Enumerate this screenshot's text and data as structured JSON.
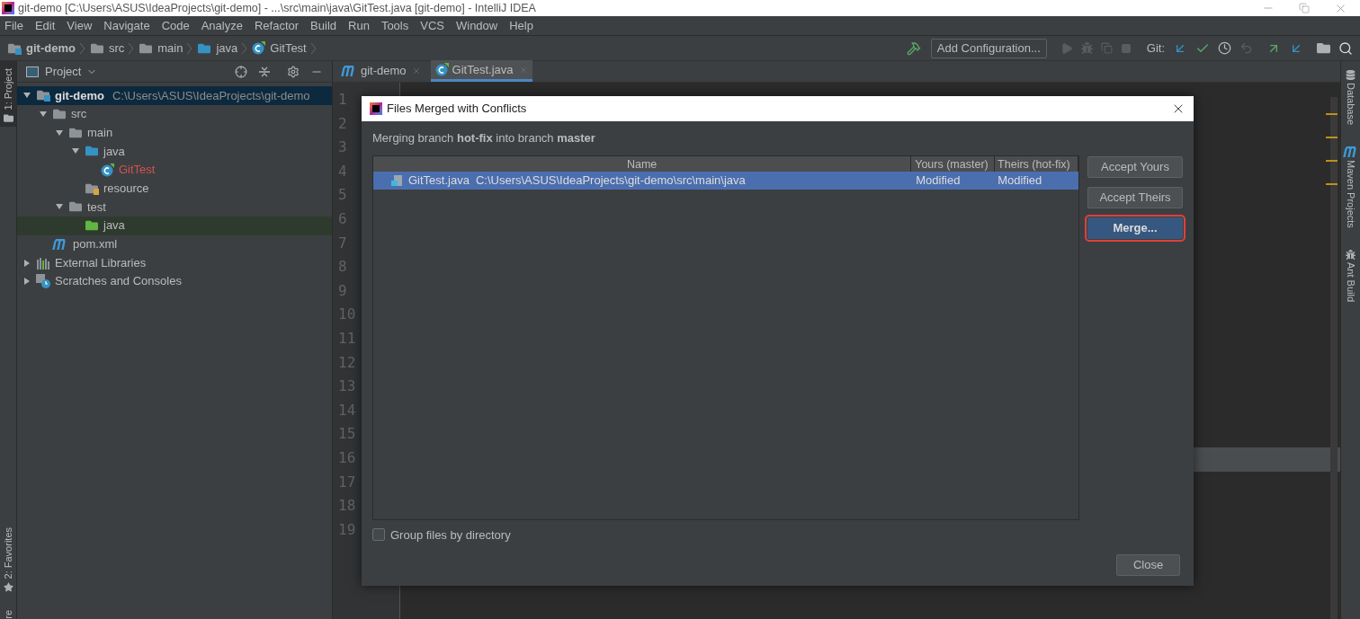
{
  "window": {
    "title": "git-demo [C:\\Users\\ASUS\\IdeaProjects\\git-demo] - ...\\src\\main\\java\\GitTest.java [git-demo] - IntelliJ IDEA"
  },
  "menu": [
    "File",
    "Edit",
    "View",
    "Navigate",
    "Code",
    "Analyze",
    "Refactor",
    "Build",
    "Run",
    "Tools",
    "VCS",
    "Window",
    "Help"
  ],
  "breadcrumb": [
    {
      "label": "git-demo",
      "kind": "module"
    },
    {
      "label": "src",
      "kind": "folder"
    },
    {
      "label": "main",
      "kind": "folder"
    },
    {
      "label": "java",
      "kind": "source"
    },
    {
      "label": "GitTest",
      "kind": "class"
    }
  ],
  "toolbar": {
    "config_button": "Add Configuration...",
    "git_label": "Git:"
  },
  "left_stripe": {
    "top": "1: Project",
    "bottom": "2: Favorites",
    "cut": "re"
  },
  "project_panel": {
    "title": "Project",
    "tree": [
      {
        "label": "git-demo",
        "hint": "C:\\Users\\ASUS\\IdeaProjects\\git-demo",
        "kind": "module",
        "expanded": true,
        "selected": true,
        "highlighted": false,
        "children": [
          {
            "label": "src",
            "kind": "folder",
            "expanded": true,
            "selected": false,
            "highlighted": false,
            "children": [
              {
                "label": "main",
                "kind": "folder",
                "expanded": true,
                "selected": false,
                "highlighted": false,
                "children": [
                  {
                    "label": "java",
                    "kind": "source",
                    "expanded": true,
                    "selected": false,
                    "highlighted": false,
                    "children": [
                      {
                        "label": "GitTest",
                        "kind": "class",
                        "color": "#d25252",
                        "selected": false,
                        "highlighted": false
                      }
                    ]
                  },
                  {
                    "label": "resource",
                    "kind": "resource",
                    "selected": false,
                    "highlighted": false
                  }
                ]
              },
              {
                "label": "test",
                "kind": "folder",
                "expanded": true,
                "selected": false,
                "highlighted": false,
                "children": [
                  {
                    "label": "java",
                    "kind": "test",
                    "selected": false,
                    "highlighted": true
                  }
                ]
              }
            ]
          },
          {
            "label": "pom.xml",
            "kind": "maven",
            "selected": false,
            "highlighted": false
          }
        ]
      },
      {
        "label": "External Libraries",
        "kind": "libraries",
        "expanded": false,
        "selected": false,
        "highlighted": false
      },
      {
        "label": "Scratches and Consoles",
        "kind": "scratches",
        "expanded": false,
        "selected": false,
        "highlighted": false
      }
    ]
  },
  "editor": {
    "tabs": [
      {
        "label": "git-demo",
        "kind": "maven",
        "selected": false
      },
      {
        "label": "GitTest.java",
        "kind": "class",
        "selected": true
      }
    ],
    "lines": [
      {
        "number": "1",
        "current": false
      },
      {
        "number": "2",
        "current": false
      },
      {
        "number": "3",
        "current": false
      },
      {
        "number": "4",
        "current": false
      },
      {
        "number": "5",
        "current": false
      },
      {
        "number": "6",
        "current": false
      },
      {
        "number": "7",
        "current": false
      },
      {
        "number": "8",
        "current": false
      },
      {
        "number": "9",
        "current": false
      },
      {
        "number": "10",
        "current": false
      },
      {
        "number": "11",
        "current": false
      },
      {
        "number": "12",
        "current": false
      },
      {
        "number": "13",
        "current": false
      },
      {
        "number": "14",
        "current": false
      },
      {
        "number": "15",
        "current": false
      },
      {
        "number": "16",
        "current": true
      },
      {
        "number": "17",
        "current": false
      },
      {
        "number": "18",
        "current": false
      },
      {
        "number": "19",
        "current": false
      }
    ]
  },
  "right_stripe": [
    "Database",
    "Maven Projects",
    "Ant Build"
  ],
  "dialog": {
    "title": "Files Merged with Conflicts",
    "message": "Merging branch **hot-fix** into branch **master**",
    "columns": [
      "Name",
      "Yours (master)",
      "Theirs (hot-fix)"
    ],
    "rows": [
      {
        "name": "GitTest.java",
        "path": "C:\\Users\\ASUS\\IdeaProjects\\git-demo\\src\\main\\java",
        "yours": "Modified",
        "theirs": "Modified",
        "selected": true
      }
    ],
    "buttons": [
      {
        "label": "Accept Yours",
        "focused": false
      },
      {
        "label": "Accept Theirs",
        "focused": false
      },
      {
        "label": "Merge...",
        "focused": true
      }
    ],
    "checkbox": {
      "label": "Group files by directory",
      "checked": false
    },
    "close_button": "Close"
  }
}
